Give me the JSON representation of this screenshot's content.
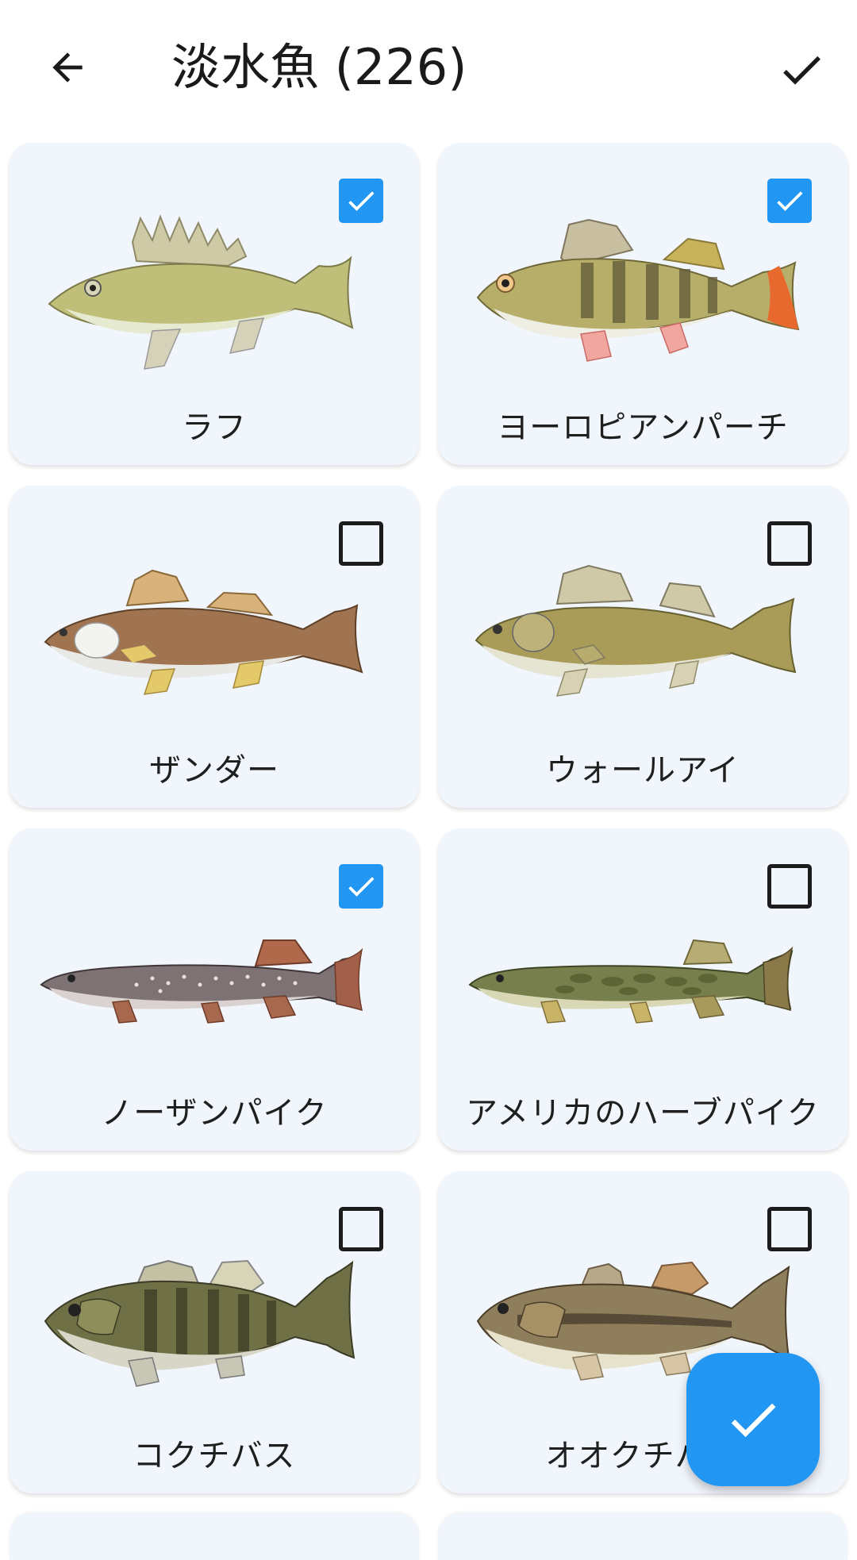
{
  "header": {
    "back_icon": "arrow-left-icon",
    "title": "淡水魚 (226)",
    "confirm_icon": "check-icon"
  },
  "cards": [
    {
      "name": "ラフ",
      "checked": true
    },
    {
      "name": "ヨーロピアンパーチ",
      "checked": true
    },
    {
      "name": "ザンダー",
      "checked": false
    },
    {
      "name": "ウォールアイ",
      "checked": false
    },
    {
      "name": "ノーザンパイク",
      "checked": true
    },
    {
      "name": "アメリカのハーブパイク",
      "checked": false
    },
    {
      "name": "コクチバス",
      "checked": false
    },
    {
      "name": "オオクチバス",
      "checked": false
    }
  ],
  "fab": {
    "icon": "check-icon"
  },
  "colors": {
    "accent": "#2196f3",
    "card_bg": "#f1f6fd"
  }
}
